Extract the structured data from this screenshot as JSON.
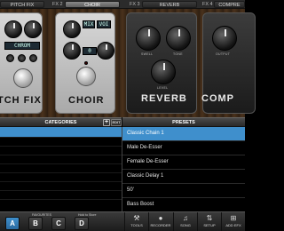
{
  "fx_bar": {
    "slot1_name": "PITCH FIX",
    "slot2_number": "FX 2",
    "slot2_name": "CHOIR",
    "slot3_number": "FX 3",
    "slot3_name": "REVERB",
    "slot4_number": "FX 4",
    "slot4_name": "COMPRE"
  },
  "pedals": {
    "pitch_fix": {
      "title": "TCH FIX",
      "lcd": "CHROM"
    },
    "choir": {
      "title": "CHOIR",
      "lcd_top": "MIX",
      "lcd_val": "VOI",
      "lcd_mid": "0"
    },
    "reverb": {
      "title": "REVERB",
      "knob1": "SWELL",
      "knob2": "TONE",
      "knob3": "LEVEL"
    },
    "compressor": {
      "title": "COMP",
      "knob1": "OUTPUT"
    }
  },
  "categories": {
    "header": "CATEGORIES",
    "add_icon": "+",
    "edit_label": "EDIT",
    "rows": [
      "",
      "",
      "",
      "",
      "",
      "",
      "",
      "",
      ""
    ]
  },
  "presets": {
    "header": "PRESETS",
    "items": [
      {
        "label": "Classic Chain 1",
        "selected": true
      },
      {
        "label": "Male De-Esser",
        "selected": false
      },
      {
        "label": "Female De-Esser",
        "selected": false
      },
      {
        "label": "Classic Delay 1",
        "selected": false
      },
      {
        "label": "50'",
        "selected": false
      },
      {
        "label": "Bass Boost",
        "selected": false
      }
    ]
  },
  "bottom_bar": {
    "favourites_label": "FAVOURITES",
    "hold_label": "Hold to Store",
    "fav_buttons": [
      "A",
      "B",
      "C",
      "D"
    ],
    "active_fav": "A",
    "tools": [
      {
        "icon": "tools-icon",
        "label": "TOOLS"
      },
      {
        "icon": "recorder-icon",
        "label": "RECORDER"
      },
      {
        "icon": "song-icon",
        "label": "SONG"
      },
      {
        "icon": "setup-icon",
        "label": "SETUP"
      },
      {
        "icon": "add-fx-icon",
        "label": "ADD EFX"
      }
    ]
  },
  "colors": {
    "selection": "#3f8fcc",
    "background": "#000000",
    "wood": "#4a321c"
  }
}
